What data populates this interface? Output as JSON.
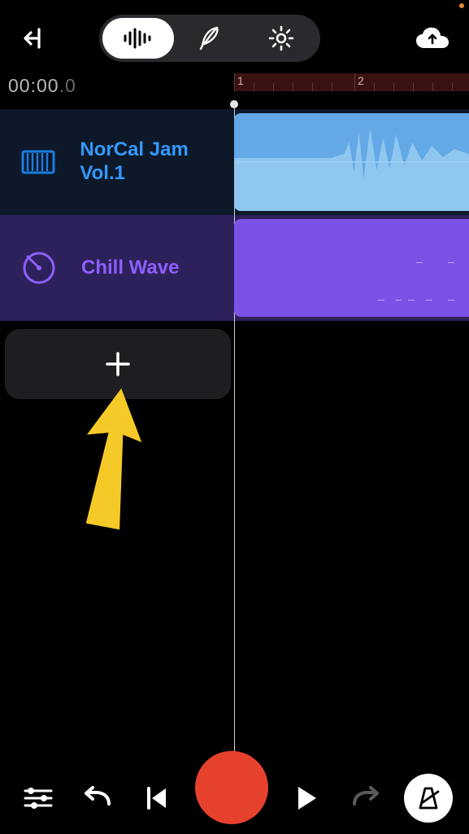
{
  "timecode": {
    "main": "00:00",
    "frac": ".0"
  },
  "ruler": {
    "markers": [
      "1",
      "2"
    ]
  },
  "tracks": [
    {
      "name": "NorCal Jam Vol.1",
      "color": "blue",
      "icon": "waveform"
    },
    {
      "name": "Chill Wave",
      "color": "purple",
      "icon": "disc"
    }
  ],
  "toolbar": {
    "mixer_label": "mixer",
    "undo_label": "undo",
    "skip_back_label": "skip-back",
    "record_label": "record",
    "play_label": "play",
    "redo_label": "redo",
    "metronome_label": "metronome"
  },
  "colors": {
    "accent_blue": "#3399ff",
    "accent_purple": "#8e5fff",
    "record_red": "#e5412d",
    "annotation_yellow": "#f5c927"
  }
}
